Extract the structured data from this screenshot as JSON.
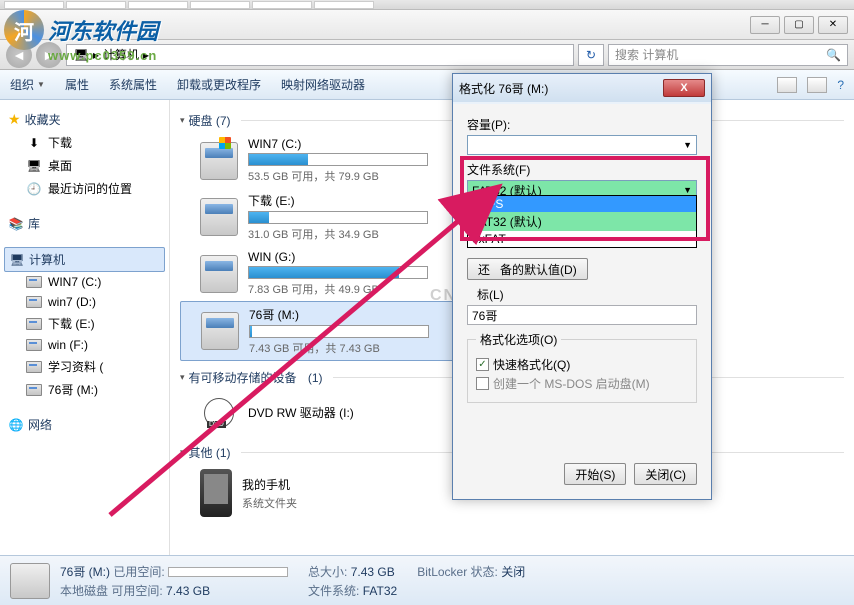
{
  "watermark": {
    "brand": "河东软件园",
    "url": "www.pc0359.cn"
  },
  "cnet_wm": "CNET",
  "nav": {
    "breadcrumb_root": "计算机",
    "search_placeholder": "搜索 计算机"
  },
  "menu": {
    "organize": "组织",
    "properties": "属性",
    "sysprops": "系统属性",
    "uninstall": "卸载或更改程序",
    "mapnet": "映射网络驱动器"
  },
  "sidebar": {
    "favorites": "收藏夹",
    "fav_items": {
      "downloads": "下载",
      "desktop": "桌面",
      "recent": "最近访问的位置"
    },
    "library": "库",
    "computer": "计算机",
    "drives": [
      {
        "label": "WIN7 (C:)"
      },
      {
        "label": "win7 (D:)"
      },
      {
        "label": "下载 (E:)"
      },
      {
        "label": "win (F:)"
      },
      {
        "label": "学习资料 ("
      },
      {
        "label": "76哥 (M:)"
      }
    ],
    "network": "网络"
  },
  "content": {
    "group_hdd": "硬盘 (7)",
    "group_removable": "有可移动存储的设备",
    "group_removable_count": "(1)",
    "group_other": "其他 (1)",
    "drives": [
      {
        "name": "WIN7 (C:)",
        "free": "53.5 GB 可用，共 79.9 GB",
        "fill": 33
      },
      {
        "name": "下载 (E:)",
        "free": "31.0 GB 可用，共 34.9 GB",
        "fill": 11
      },
      {
        "name": "WIN (G:)",
        "free": "7.83 GB 可用，共 49.9 GB",
        "fill": 84
      },
      {
        "name": "76哥 (M:)",
        "free": "7.43 GB 可用，共 7.43 GB",
        "fill": 1
      }
    ],
    "dvd": "DVD RW 驱动器 (I:)",
    "phone": {
      "name": "我的手机",
      "sub": "系统文件夹"
    }
  },
  "status": {
    "drive": "76哥 (M:)",
    "type": "本地磁盘",
    "used_label": "已用空间:",
    "avail_label": "可用空间:",
    "avail_val": "7.43 GB",
    "total_label": "总大小:",
    "total_val": "7.43 GB",
    "fs_label": "文件系统:",
    "fs_val": "FAT32",
    "bitlocker_label": "BitLocker 状态:",
    "bitlocker_val": "关闭"
  },
  "format": {
    "title": "格式化 76哥 (M:)",
    "capacity_label": "容量(P):",
    "fs_label": "文件系统(F)",
    "fs_value": "FAT32 (默认)",
    "fs_options": {
      "ntfs": "NTFS",
      "fat32": "FAT32 (默认)",
      "exfat": "exFAT"
    },
    "restore_btn": "备的默认值(D)",
    "restore_prefix": "还",
    "vol_label_text": "标(L)",
    "vol_value": "76哥",
    "options_legend": "格式化选项(O)",
    "quick": "快速格式化(Q)",
    "msdos": "创建一个 MS-DOS 启动盘(M)",
    "start": "开始(S)",
    "close": "关闭(C)"
  }
}
